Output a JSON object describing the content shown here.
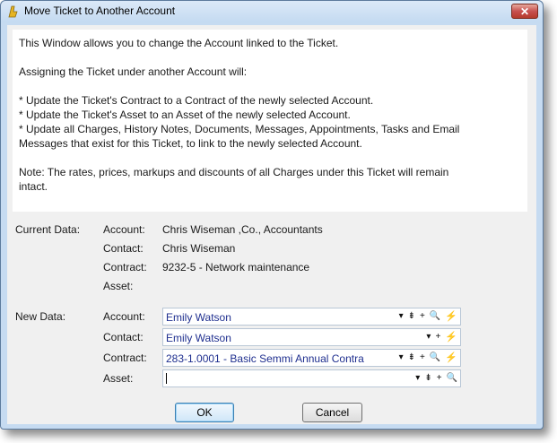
{
  "window": {
    "title": "Move Ticket to Another Account",
    "close_label": "✕"
  },
  "info": {
    "intro": "This Window allows you to change the Account linked to the Ticket.",
    "assign": "Assigning the Ticket under another Account will:",
    "bullet1": "* Update the Ticket's Contract to a Contract of the newly selected Account.",
    "bullet2": "* Update the Ticket's Asset to an Asset of the newly selected Account.",
    "bullet3a": "* Update all Charges, History Notes, Documents, Messages, Appointments, Tasks and Email",
    "bullet3b": "Messages that exist for this Ticket, to link to the newly selected Account.",
    "note_a": "Note: The rates, prices, markups and discounts of all Charges under this Ticket will remain",
    "note_b": "intact."
  },
  "current": {
    "section_label": "Current Data:",
    "account_label": "Account:",
    "account_value": "Chris Wiseman ,Co., Accountants",
    "contact_label": "Contact:",
    "contact_value": "Chris Wiseman",
    "contract_label": "Contract:",
    "contract_value": "9232-5 - Network maintenance",
    "asset_label": "Asset:",
    "asset_value": ""
  },
  "new_data": {
    "section_label": "New Data:",
    "account_label": "Account:",
    "account_value": "Emily Watson",
    "contact_label": "Contact:",
    "contact_value": "Emily Watson",
    "contract_label": "Contract:",
    "contract_value": "283-1.0001 - Basic Semmi Annual Contra",
    "asset_label": "Asset:",
    "asset_value": ""
  },
  "icons": {
    "dropdown": "▾",
    "filter": "⇟",
    "add": "+",
    "search": "🔍",
    "quick": "⚡"
  },
  "buttons": {
    "ok": "OK",
    "cancel": "Cancel"
  }
}
